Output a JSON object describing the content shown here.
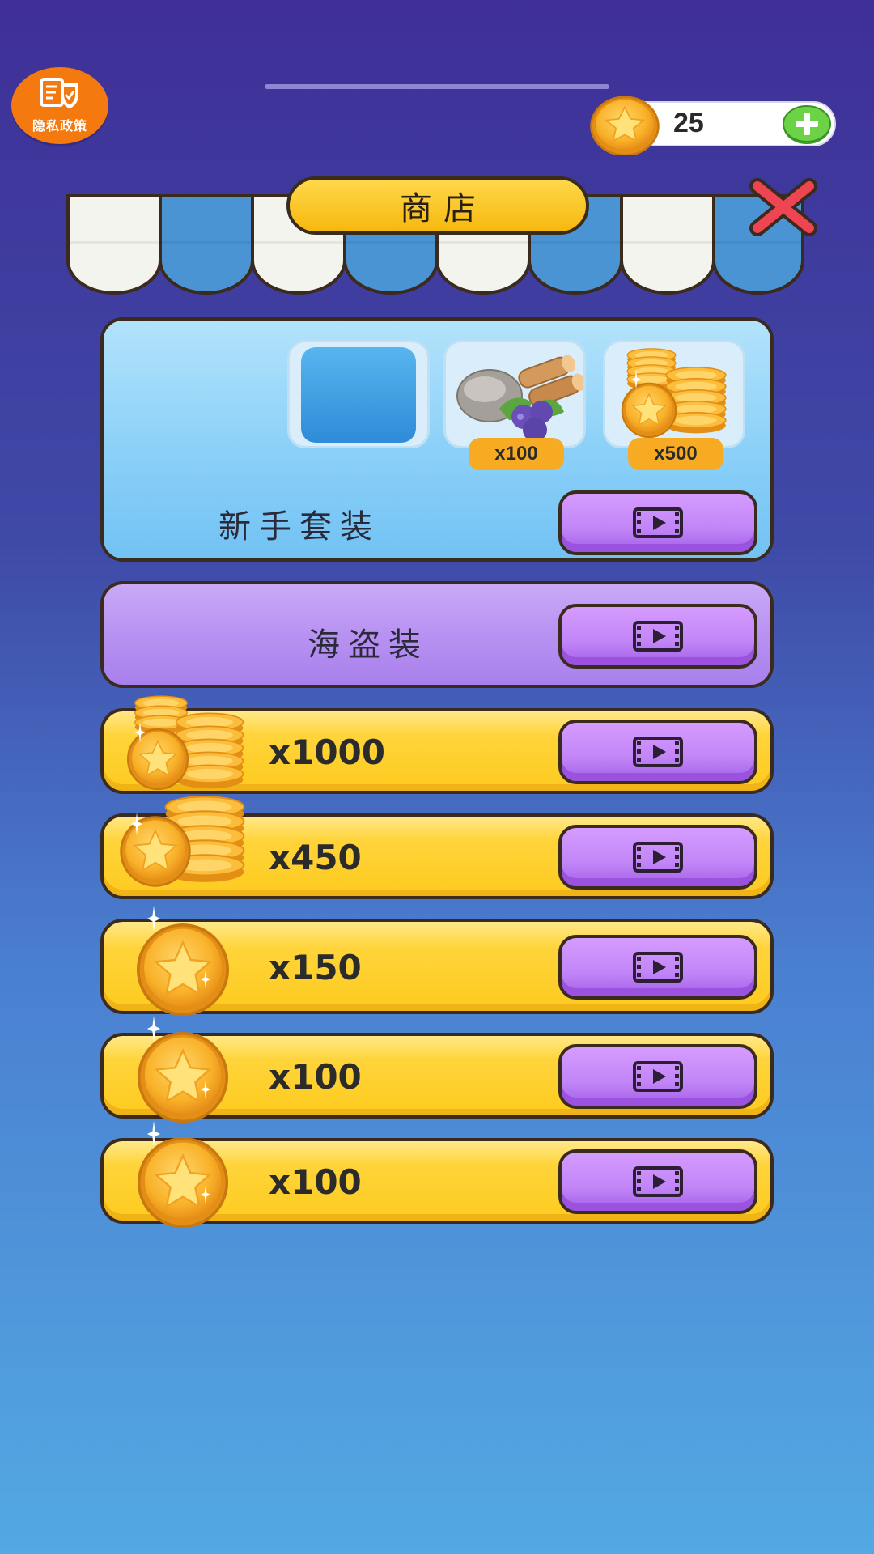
{
  "privacy": {
    "label": "隐私政策",
    "icon": "privacy-doc-shield-icon"
  },
  "currency": {
    "amount": "25",
    "icon": "coin-star-icon",
    "add_icon": "plus-icon"
  },
  "shop": {
    "title": "商店",
    "close_icon": "close-x-icon"
  },
  "starter_pack": {
    "label": "新手套装",
    "items": [
      {
        "icon": "pirate-character-icon"
      },
      {
        "icon": "resources-bundle-icon",
        "qty": "x100"
      },
      {
        "icon": "coin-stack-icon",
        "qty": "x500"
      }
    ],
    "button_icon": "video-play-icon"
  },
  "pirate_outfit": {
    "label": "海盗装",
    "icon": "pirate-character-icon",
    "button_icon": "video-play-icon"
  },
  "coin_offers": [
    {
      "amount": "x1000",
      "icon": "coin-stack-large-icon"
    },
    {
      "amount": "x450",
      "icon": "coin-stack-medium-icon"
    },
    {
      "amount": "x150",
      "icon": "coin-single-icon"
    },
    {
      "amount": "x100",
      "icon": "coin-single-icon"
    },
    {
      "amount": "x100",
      "icon": "coin-single-icon"
    }
  ],
  "colors": {
    "accent_purple": "#c285f7",
    "coin_gold": "#f9b22a",
    "card_yellow": "#fecb1f",
    "outline": "#3b2a1e"
  }
}
